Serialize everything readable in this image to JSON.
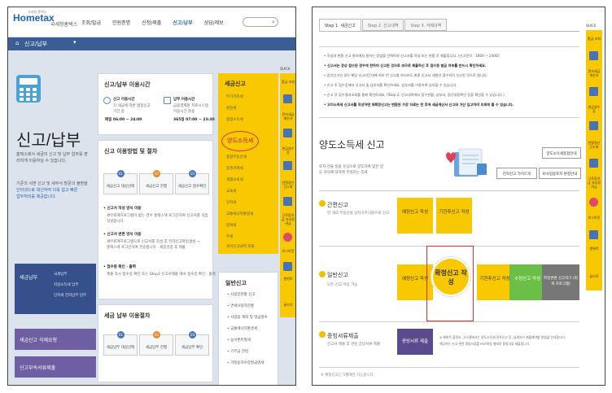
{
  "left": {
    "logo": {
      "main": "Hometax",
      "sub": "국세청홈택스",
      "tiny": "국세청 홈택스"
    },
    "nav": [
      "조회/발급",
      "민원증명",
      "신청/제출",
      "신고/납부",
      "상담/제보"
    ],
    "subbar": {
      "title": "신고/납부"
    },
    "page_title": "신고/납부",
    "intro": "홈택스에서 세금의 신고 및 납부 업무를 편리하게 이용하실 수 있습니다.",
    "intro2_a": "기준의 서면 신고 및 세무서 방문의 불편을",
    "intro2_b": "인터넷으로 대신하여 더욱 쉽고 빠른",
    "intro2_c": "업무처리를 제공합니다.",
    "left_nav": {
      "main": "세금납부",
      "subs": [
        "국세납부",
        "지방소득세 납부",
        "인지세 전자납부 납부"
      ]
    },
    "left_buttons": [
      "세금신고 삭제요청",
      "신고부속서류제출"
    ],
    "hours_card": {
      "title": "신고/납부 이용시간",
      "col1_title": "신고 이용시간",
      "col1_line1": "각 세금에 따른 법정신고",
      "col1_line2": "기간 중",
      "col1_time": "매일 06:00 ~ 24:00",
      "col2_title": "납부 이용시간",
      "col2_line1": "금융결제원 지로시스템",
      "col2_line2": "이용시간 준용",
      "col2_time": "365일 07:00 ~ 23:30"
    },
    "process_card": {
      "title": "신고 이용방법 및 절차",
      "steps": [
        {
          "n": "01",
          "label": "세금신고 대상선택"
        },
        {
          "n": "02",
          "label": "세금신고 진행"
        },
        {
          "n": "03",
          "label": "세금신고 접수확인"
        }
      ],
      "items": [
        {
          "title": "• 신고서 작성 방식 이용",
          "desc1": "세무회계프로그램이 없는 경우 홈택스에 로그인하여 신고서를 직접",
          "desc2": "작성합니다."
        },
        {
          "title": "• 신고서 변환 방식 이용",
          "desc1": "세무회계프로그램으로 신고서를 작성 후 전자신고파일생성 →",
          "desc2": "홈택스에 로그인하여 전송합니다 · 세종검증 후 제출"
        },
        {
          "title": "• 접수증 확인 · 출력",
          "desc1": "제출 즉시 접수증 확인 또는 Step3 신고서제출 에서 접수증 확인 · 출력",
          "desc2": ""
        }
      ]
    },
    "pay_card": {
      "title": "세금 납부 이용절차",
      "steps": [
        {
          "n": "01",
          "label": "세금납부 대상선택"
        },
        {
          "n": "02",
          "label": "세금납부 진행"
        },
        {
          "n": "03",
          "label": "세금납부 확인"
        }
      ]
    },
    "yellow_panel": {
      "title": "세금신고",
      "items": [
        "부가가치세",
        "원천세",
        "종합소득세",
        "양도소득세",
        "종합부동산세",
        "증권거래세",
        "개별소비세",
        "교육세",
        "인지세",
        "교통에너지환경세",
        "증여세"
      ],
      "more_items": [
        "주세",
        "과거신고내역 조회"
      ],
      "highlight": "양도소득세"
    },
    "white_panel": {
      "title": "일반신고",
      "items": [
        "• 사업장현황 신고",
        "• 면세사업자현황",
        "• 사업용 계좌 및 현금영수",
        "• 교통에너지환경세",
        "• 농어촌특별세",
        "• 기부금 관련",
        "• 가정용자수증발급명세"
      ]
    },
    "quick": {
      "head": "QUICK",
      "items": [
        "환급 조회",
        "전자세금 계산서",
        "현금영수증",
        "연말정산 간소화",
        "근로장려금 자녀장려금",
        "로그아웃",
        "맨위로",
        "끝으로"
      ]
    }
  },
  "right": {
    "tabs": [
      "Step 1. 세금신고",
      "Step 2. 신고내역",
      "Step 3. 삭제내역"
    ],
    "notice": [
      {
        "text": "• 작성과 변환 신고 절차에서 원하는 방법을 선택하여 신고서를 작성 또는 변환 후 제출합니다. (신고문의 : 1600 ~ 2400)",
        "bold": false
      },
      {
        "text": "• 신고서는 정상 접수된 경우에 한하여 신고된 것으로 보므로 제출하신 후 접수증 발급 여부를 반드시 확인하세요.",
        "bold": true
      },
      {
        "text": "• 정기신고인 경우 해당 신고기간내에 여러 번 신고를 하더라도 최종 신고서 내용만 접수되어 신고된 것으로 봅니다.",
        "bold": false
      },
      {
        "text": "• 신고 후 접수증에서 신고서 및 납부서를 확인하세요. 납부서를 이용하여 납부할 수 있습니다.",
        "bold": false
      },
      {
        "text": "• 신고 후 접수결과조회를 통해 확인하세요. (Step 2. 신고내역에서 접수현황, 납부서, 접수내용확인 등을 확인할 수 있습니다.)",
        "bold": false
      },
      {
        "text": "• 오미소득세 신고서를 작성하면 재확정신고는 변환된 가장 자료는 한 후에 세금계산서 신고와 가산 입고하여 조회에 볼 수 있습니다.",
        "bold": true
      }
    ],
    "title": "양도소득세 신고",
    "desc": "토지·건물 등을 유상으로 양도하여 얻은 양도 차익에 대하여 부과하는 조세",
    "guide_buttons": [
      "양도소득세종합안내",
      "전자신고 가이드북",
      "비사업용토지 판정안내"
    ],
    "sections": [
      {
        "title": "간편신고",
        "desc": "한 개의 부동산을 납자거주기준으로 신고",
        "buttons": [
          "예정신고 작성",
          "기한후신고 작성"
        ]
      },
      {
        "title": "일반신고",
        "desc": "모든 신고 이용 가능",
        "buttons": [
          "예정신고 작성",
          "확정신고 작성",
          "기한후신고 작성",
          "수정신고 작성",
          "파일변환 신고하기 (회계 프로그램)"
        ]
      },
      {
        "title": "증빙서류제출",
        "desc": "신고서 제출 후 관련 증빙서류 제출",
        "buttons": [
          "증빙서류 제출"
        ],
        "note1": "※ 해외주 출력시. 시스템에서는 양도소득세 전자신고 후, 납세자가 제출해야할 방법을 안내합니다.",
        "note2": "해당하는 신고 관련 증빙서류를 PDF파일 형태로 증빙서류 제출합니다."
      }
    ],
    "footer": "※ 확정신고는 5월에만 가능합니다.",
    "quick": {
      "head": "QUICK",
      "items": [
        "환급 조회",
        "전자세금 계산서",
        "현금영수증",
        "연말정산 간소화",
        "근로장려금 자녀장려금",
        "로그아웃",
        "맨위로",
        "끝으로"
      ]
    }
  }
}
